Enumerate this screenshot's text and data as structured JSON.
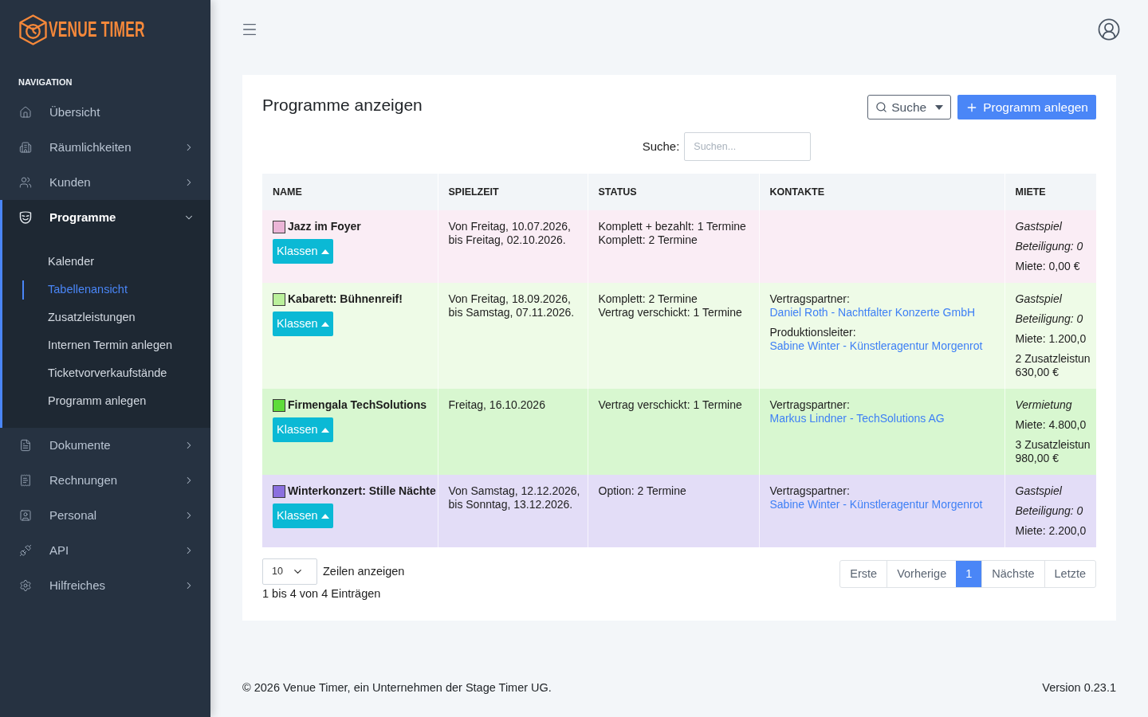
{
  "sidebar": {
    "logo": "VENUE TIMER",
    "section_title": "NAVIGATION",
    "items": [
      {
        "label": "Übersicht",
        "kind": "link",
        "selected": false
      },
      {
        "label": "Räumlichkeiten",
        "kind": "group",
        "selected": false,
        "expanded": false
      },
      {
        "label": "Kunden",
        "kind": "group",
        "selected": false,
        "expanded": false
      },
      {
        "label": "Programme",
        "kind": "group",
        "selected": true,
        "expanded": true,
        "children": [
          {
            "label": "Kalender",
            "selected": false
          },
          {
            "label": "Tabellenansicht",
            "selected": true
          },
          {
            "label": "Zusatzleistungen",
            "selected": false
          },
          {
            "label": "Internen Termin anlegen",
            "selected": false
          },
          {
            "label": "Ticketvorverkaufstände",
            "selected": false
          },
          {
            "label": "Programm anlegen",
            "selected": false
          }
        ]
      },
      {
        "label": "Dokumente",
        "kind": "group",
        "selected": false,
        "expanded": false
      },
      {
        "label": "Rechnungen",
        "kind": "group",
        "selected": false,
        "expanded": false
      },
      {
        "label": "Personal",
        "kind": "group",
        "selected": false,
        "expanded": false
      },
      {
        "label": "API",
        "kind": "group",
        "selected": false,
        "expanded": false
      },
      {
        "label": "Hilfreiches",
        "kind": "group",
        "selected": false,
        "expanded": false
      }
    ]
  },
  "page": {
    "title": "Programme anzeigen",
    "search_button": "Suche",
    "create_button": "Programm anlegen",
    "search": {
      "label": "Suche:",
      "placeholder": "Suchen..."
    },
    "table": {
      "columns": [
        "NAME",
        "SPIELZEIT",
        "STATUS",
        "KONTAKTE",
        "MIETE"
      ],
      "rows": [
        {
          "color": "#ebb5d7",
          "name": "Jazz im Foyer",
          "button": "Klassen",
          "spielzeit": [
            "Von Freitag, 10.07.2026,",
            "bis Freitag, 02.10.2026."
          ],
          "status": [
            "Komplett + bezahlt: 1 Termine",
            "Komplett: 2 Termine"
          ],
          "miete": [
            {
              "kind": "note",
              "lines": [
                "Gastspiel"
              ]
            },
            {
              "kind": "note",
              "lines": [
                "Beteiligung: 0"
              ]
            },
            {
              "kind": "amount",
              "lines": [
                "Miete: 0,00 €"
              ]
            }
          ]
        },
        {
          "color": "#baf09b",
          "name": "Kabarett: Bühnenreif!",
          "button": "Klassen",
          "spielzeit": [
            "Von Freitag, 18.09.2026,",
            "bis Samstag, 07.11.2026."
          ],
          "status": [
            "Komplett: 2 Termine",
            "Vertrag verschickt: 1 Termine"
          ],
          "kontakte": [
            {
              "role": "Vertragspartner:",
              "name": "Daniel Roth - Nachtfalter Konzerte GmbH"
            },
            {
              "role": "Produktionsleiter:",
              "name": "Sabine Winter - Künstleragentur Morgenrot"
            }
          ],
          "miete": [
            {
              "kind": "note",
              "lines": [
                "Gastspiel"
              ]
            },
            {
              "kind": "note",
              "lines": [
                "Beteiligung: 0"
              ]
            },
            {
              "kind": "amount",
              "lines": [
                "Miete: 1.200,0"
              ]
            },
            {
              "kind": "amount",
              "lines": [
                "2 Zusatzleistun",
                "630,00 €"
              ]
            }
          ]
        },
        {
          "color": "#5edc3a",
          "name": "Firmengala TechSolutions",
          "button": "Klassen",
          "spielzeit": [
            "Freitag, 16.10.2026"
          ],
          "status": [
            "Vertrag verschickt: 1 Termine"
          ],
          "kontakte": [
            {
              "role": "Vertragspartner:",
              "name": "Markus Lindner - TechSolutions AG"
            }
          ],
          "miete": [
            {
              "kind": "note",
              "lines": [
                "Vermietung"
              ]
            },
            {
              "kind": "amount",
              "lines": [
                "Miete: 4.800,0"
              ]
            },
            {
              "kind": "amount",
              "lines": [
                "3 Zusatzleistun",
                "980,00 €"
              ]
            }
          ]
        },
        {
          "color": "#8b70df",
          "name": "Winterkonzert: Stille Nächte",
          "button": "Klassen",
          "spielzeit": [
            "Von Samstag, 12.12.2026,",
            "bis Sonntag, 13.12.2026."
          ],
          "status": [
            "Option: 2 Termine"
          ],
          "kontakte": [
            {
              "role": "Vertragspartner:",
              "name": "Sabine Winter - Künstleragentur Morgenrot"
            }
          ],
          "miete": [
            {
              "kind": "note",
              "lines": [
                "Gastspiel"
              ]
            },
            {
              "kind": "note",
              "lines": [
                "Beteiligung: 0"
              ]
            },
            {
              "kind": "amount",
              "lines": [
                "Miete: 2.200,0"
              ]
            }
          ]
        }
      ]
    },
    "page_length": {
      "value": "10",
      "label": "Zeilen anzeigen"
    },
    "info": "1 bis 4 von 4 Einträgen",
    "pagination": [
      {
        "label": "Erste",
        "selected": false
      },
      {
        "label": "Vorherige",
        "selected": false
      },
      {
        "label": "1",
        "selected": true
      },
      {
        "label": "Nächste",
        "selected": false
      },
      {
        "label": "Letzte",
        "selected": false
      }
    ]
  },
  "footer": {
    "copyright": "© 2026 Venue Timer, ein Unternehmen der Stage Timer UG.",
    "version": "Version 0.23.1"
  }
}
